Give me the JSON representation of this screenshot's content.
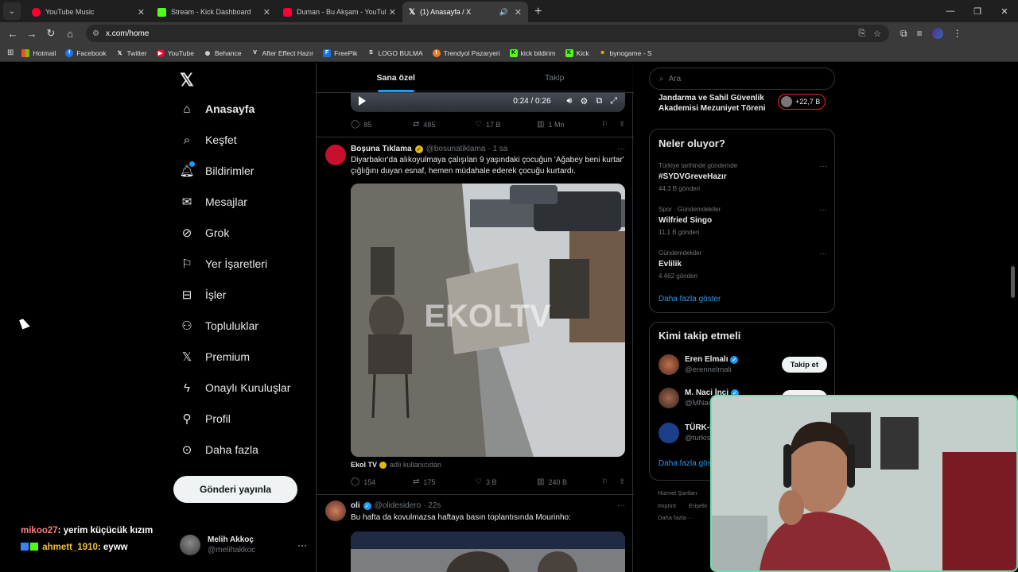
{
  "browser": {
    "tabs": [
      {
        "title": "YouTube Music",
        "color": "#ff0033",
        "active": false,
        "audio": false
      },
      {
        "title": "Stream - Kick Dashboard",
        "color": "#53fc18",
        "active": false,
        "audio": false
      },
      {
        "title": "Duman - Bu Akşam - YouTube",
        "color": "#ff0033",
        "active": false,
        "audio": false
      },
      {
        "title": "(1) Anasayfa / X",
        "color": "#e7e9ea",
        "active": true,
        "audio": true
      }
    ],
    "url": "x.com/home",
    "bookmarks": [
      {
        "label": "Hotmail",
        "icon": "microsoft-icon",
        "color": "#f25022"
      },
      {
        "label": "Facebook",
        "icon": "facebook-icon",
        "color": "#1877f2"
      },
      {
        "label": "Twitter",
        "icon": "x-icon",
        "color": "#000000"
      },
      {
        "label": "YouTube",
        "icon": "youtube-icon",
        "color": "#ff0033"
      },
      {
        "label": "Behance",
        "icon": "globe-icon",
        "color": "#555555"
      },
      {
        "label": "After Effect Hazır",
        "icon": "v-icon",
        "color": "#444444"
      },
      {
        "label": "FreePik",
        "icon": "freepik-icon",
        "color": "#1273eb"
      },
      {
        "label": "LOGO BULMA",
        "icon": "s-icon",
        "color": "#222222"
      },
      {
        "label": "Trendyol Pazaryeri",
        "icon": "trendyol-icon",
        "color": "#f27a1a"
      },
      {
        "label": "kick bildirim",
        "icon": "kick-icon",
        "color": "#53fc18"
      },
      {
        "label": "Kick",
        "icon": "kick-icon",
        "color": "#53fc18"
      },
      {
        "label": "bynogame - S",
        "icon": "bynogame-icon",
        "color": "#e6b800"
      }
    ]
  },
  "nav": {
    "items": [
      {
        "label": "Anasayfa",
        "icon": "home-icon",
        "active": true
      },
      {
        "label": "Keşfet",
        "icon": "search-icon",
        "active": false
      },
      {
        "label": "Bildirimler",
        "icon": "bell-icon",
        "active": false
      },
      {
        "label": "Mesajlar",
        "icon": "mail-icon",
        "active": false
      },
      {
        "label": "Grok",
        "icon": "grok-icon",
        "active": false
      },
      {
        "label": "Yer İşaretleri",
        "icon": "bookmark-icon",
        "active": false
      },
      {
        "label": "İşler",
        "icon": "briefcase-icon",
        "active": false
      },
      {
        "label": "Topluluklar",
        "icon": "people-icon",
        "active": false
      },
      {
        "label": "Premium",
        "icon": "x-icon",
        "active": false
      },
      {
        "label": "Onaylı Kuruluşlar",
        "icon": "lightning-icon",
        "active": false
      },
      {
        "label": "Profil",
        "icon": "person-icon",
        "active": false
      },
      {
        "label": "Daha fazla",
        "icon": "more-circle-icon",
        "active": false
      }
    ],
    "post_button": "Gönderi yayınla",
    "user": {
      "name": "Melih Akkoç",
      "handle": "@melihakkoc"
    }
  },
  "chat": [
    {
      "user": "mikoo27",
      "message": ": yerim küçücük kızım"
    },
    {
      "user": "ahmett_1910",
      "message": ": eyww"
    }
  ],
  "timeline": {
    "tabs": [
      "Sana özel",
      "Takip"
    ],
    "player": {
      "time": "0:24 / 0:26"
    },
    "post1_actions": {
      "replies": "85",
      "reposts": "485",
      "likes": "17 B",
      "views": "1 Mn"
    },
    "post2": {
      "name": "Boşuna Tıklama",
      "handle": "@bosunatiklama",
      "time": "· 1 sa",
      "text": "Diyarbakır'da alıkoyulmaya çalışılan 9 yaşındaki çocuğun 'Ağabey beni kurtar' çığlığını duyan esnaf, hemen müdahale ederek çocuğu kurtardı.",
      "watermark": "EKOLTV",
      "source_name": "Ekol TV",
      "source_note": "adlı kullanıcıdan",
      "replies": "154",
      "reposts": "175",
      "likes": "3 B",
      "views": "240 B"
    },
    "post3": {
      "name": "oli",
      "handle": "@olidesidero",
      "time": "· 22s",
      "text": "Bu hafta da kovulmazsa haftaya basın toplantısında Mourinho:"
    }
  },
  "right": {
    "search_placeholder": "Ara",
    "top_trend": "Jandarma ve Sahil Güvenlik Akademisi Mezuniyet Töreni",
    "top_trend_count": "+22,7 B",
    "trends_title": "Neler oluyor?",
    "trends": [
      {
        "category": "Türkiye tarihinde gündemde",
        "name": "#SYDVGreveHazır",
        "count": "44,3 B gönderi"
      },
      {
        "category": "Spor · Gündemdekiler",
        "name": "Wilfried Singo",
        "count": "11,1 B gönderi"
      },
      {
        "category": "Gündemdekiler",
        "name": "Evlilik",
        "count": "4.462 gönderi"
      }
    ],
    "show_more": "Daha fazla göster",
    "who_title": "Kimi takip etmeli",
    "who": [
      {
        "name": "Eren Elmalı",
        "handle": "@erennelmali",
        "button": "Takip et"
      },
      {
        "name": "M. Naci İnci",
        "handle": "@MNac",
        "button": "Takip et"
      },
      {
        "name": "TÜRK-İ",
        "handle": "@turkis",
        "button": ""
      }
    ],
    "who_more": "Daha fazla gös",
    "footer": [
      "Hizmet Şartları",
      "Imprint",
      "Erişebi",
      "Daha fazla ···"
    ]
  }
}
